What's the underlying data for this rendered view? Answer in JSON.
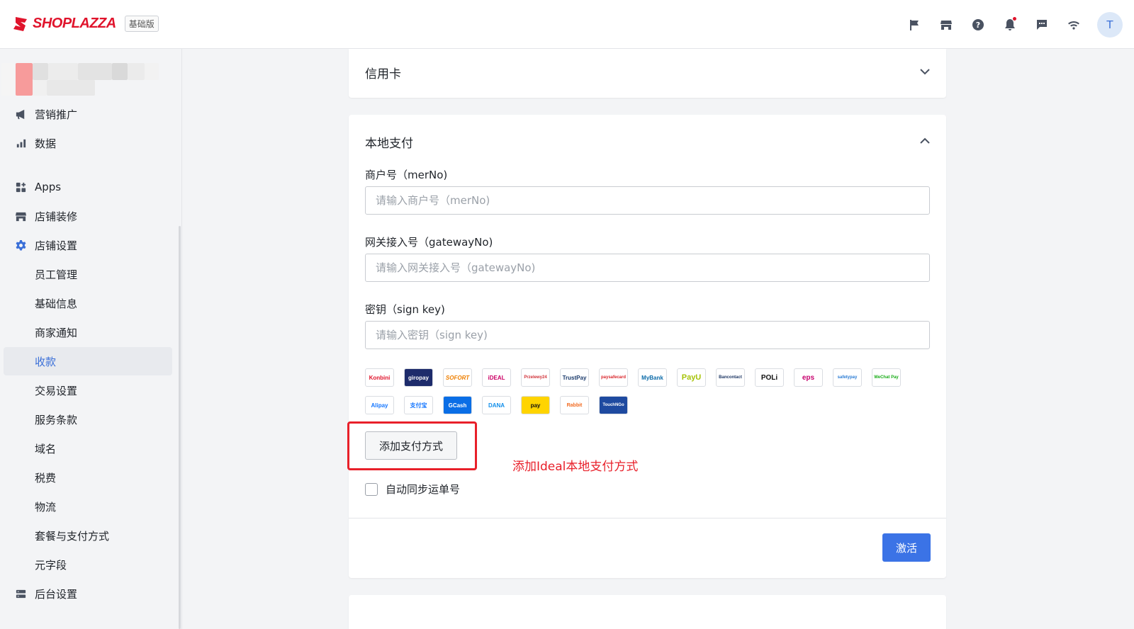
{
  "header": {
    "brand": "SHOPLAZZA",
    "plan_badge": "基础版",
    "icons": [
      "flag-icon",
      "store-icon",
      "help-icon",
      "bell-icon",
      "message-icon",
      "wifi-icon"
    ],
    "avatar_initial": "T",
    "brand_color": "#e0142c"
  },
  "sidebar": {
    "items": [
      {
        "label": "营销推广",
        "icon": "megaphone-icon"
      },
      {
        "label": "数据",
        "icon": "bar-chart-icon"
      },
      {
        "label": "Apps",
        "icon": "apps-icon"
      },
      {
        "label": "店铺装修",
        "icon": "store-icon"
      },
      {
        "label": "店铺设置",
        "icon": "gear-icon"
      },
      {
        "label": "员工管理"
      },
      {
        "label": "基础信息"
      },
      {
        "label": "商家通知"
      },
      {
        "label": "收款",
        "active": true
      },
      {
        "label": "交易设置"
      },
      {
        "label": "服务条款"
      },
      {
        "label": "域名"
      },
      {
        "label": "税费"
      },
      {
        "label": "物流"
      },
      {
        "label": "套餐与支付方式"
      },
      {
        "label": "元字段"
      },
      {
        "label": "后台设置",
        "icon": "server-icon"
      }
    ],
    "active_color": "#3a6fd8"
  },
  "main": {
    "credit_card": {
      "title": "信用卡"
    },
    "local_pay": {
      "title": "本地支付",
      "fields": [
        {
          "label": "商户号（merNo)",
          "placeholder": "请输入商户号（merNo)"
        },
        {
          "label": "网关接入号（gatewayNo)",
          "placeholder": "请输入网关接入号（gatewayNo)"
        },
        {
          "label": "密钥（sign key)",
          "placeholder": "请输入密钥（sign key)"
        }
      ],
      "payment_logos": [
        "Konbini",
        "giropay",
        "SOFORT",
        "iDEAL",
        "Przelewy24",
        "TrustPay",
        "paysafecard",
        "MyBank",
        "PayU",
        "Bancontact",
        "POLi",
        "eps",
        "safetypay",
        "WeChat Pay",
        "Alipay",
        "支付宝",
        "GCash",
        "DANA",
        "pay",
        "Rabbit",
        "TouchNGo"
      ],
      "add_button": "添加支付方式",
      "annotation": "添加Ideal本地支付方式",
      "auto_sync_label": "自动同步运单号",
      "activate_button": "激活"
    },
    "accent_color": "#3b73e6",
    "annotation_color": "#e8202a"
  }
}
